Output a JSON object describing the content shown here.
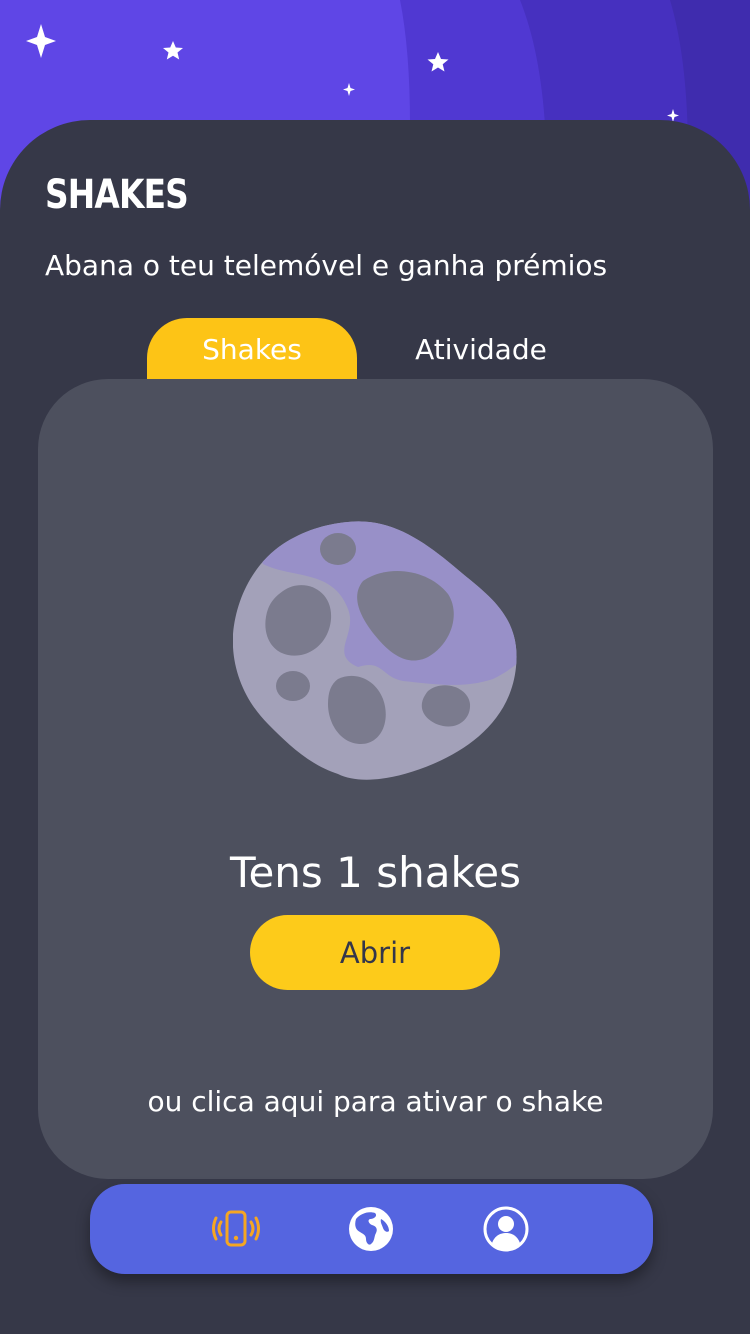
{
  "header": {
    "title": "SHAKES",
    "subtitle": "Abana o teu telemóvel e ganha prémios"
  },
  "tabs": [
    {
      "label": "Shakes",
      "active": true
    },
    {
      "label": "Atividade",
      "active": false
    }
  ],
  "card": {
    "shakes_text": "Tens 1 shakes",
    "open_button_label": "Abrir",
    "activate_text": "ou clica aqui para ativar o shake"
  },
  "bottom_nav": {
    "items": [
      {
        "icon": "phone-vibrate-icon",
        "active": true
      },
      {
        "icon": "globe-icon",
        "active": false
      },
      {
        "icon": "user-profile-icon",
        "active": false
      }
    ]
  },
  "colors": {
    "background": "#363848",
    "sky_purple": "#5c44e0",
    "accent_yellow": "#fdc416",
    "card": "#4d505e",
    "nav": "#5565e0",
    "active_icon": "#f5a623"
  }
}
